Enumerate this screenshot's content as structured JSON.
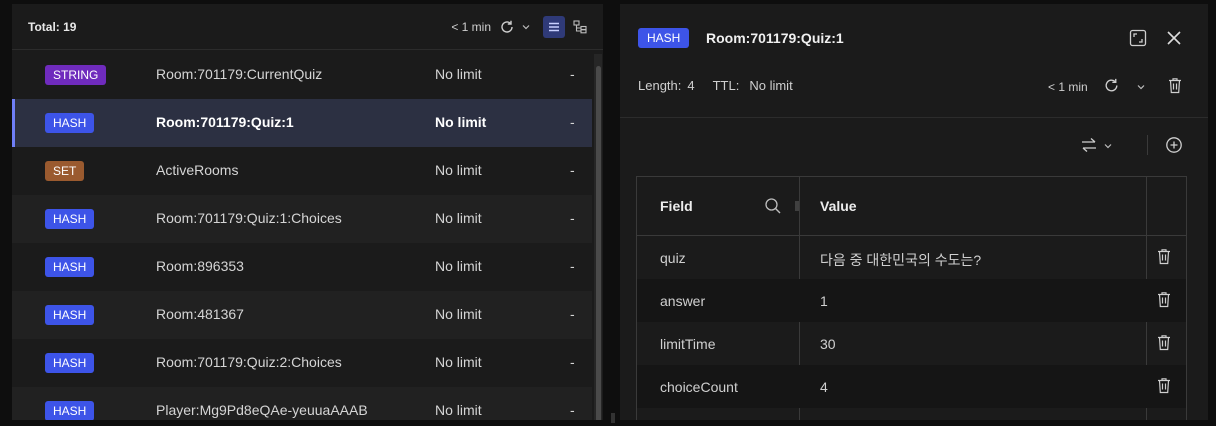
{
  "key_list": {
    "total_label": "Total: 19",
    "refresh_age": "< 1 min",
    "icons": {
      "refresh": "refresh-icon",
      "dropdown": "chevron-down-icon",
      "list_view": "list-view-icon",
      "tree_view": "tree-view-icon"
    },
    "rows": [
      {
        "type": "STRING",
        "name": "Room:701179:CurrentQuiz",
        "ttl": "No limit",
        "size": "-",
        "selected": false
      },
      {
        "type": "HASH",
        "name": "Room:701179:Quiz:1",
        "ttl": "No limit",
        "size": "-",
        "selected": true
      },
      {
        "type": "SET",
        "name": "ActiveRooms",
        "ttl": "No limit",
        "size": "-",
        "selected": false
      },
      {
        "type": "HASH",
        "name": "Room:701179:Quiz:1:Choices",
        "ttl": "No limit",
        "size": "-",
        "selected": false
      },
      {
        "type": "HASH",
        "name": "Room:896353",
        "ttl": "No limit",
        "size": "-",
        "selected": false
      },
      {
        "type": "HASH",
        "name": "Room:481367",
        "ttl": "No limit",
        "size": "-",
        "selected": false
      },
      {
        "type": "HASH",
        "name": "Room:701179:Quiz:2:Choices",
        "ttl": "No limit",
        "size": "-",
        "selected": false
      },
      {
        "type": "HASH",
        "name": "Player:Mg9Pd8eQAe-yeuuaAAAB",
        "ttl": "No limit",
        "size": "-",
        "selected": false
      }
    ]
  },
  "details": {
    "type": "HASH",
    "key_name": "Room:701179:Quiz:1",
    "length_label": "Length:",
    "length_value": "4",
    "ttl_label": "TTL:",
    "ttl_value": "No limit",
    "refresh_age": "< 1 min",
    "icons": {
      "fullscreen": "fullscreen-icon",
      "close": "close-icon",
      "refresh": "refresh-icon",
      "dropdown": "chevron-down-icon",
      "delete": "trash-icon",
      "format": "swap-arrows-icon",
      "add": "plus-circle-icon",
      "search": "search-icon"
    },
    "table": {
      "field_header": "Field",
      "value_header": "Value",
      "rows": [
        {
          "field": "quiz",
          "value": "다음 중 대한민국의 수도는?"
        },
        {
          "field": "answer",
          "value": "1"
        },
        {
          "field": "limitTime",
          "value": "30"
        },
        {
          "field": "choiceCount",
          "value": "4"
        }
      ]
    }
  },
  "colors": {
    "hash": "#3d54e8",
    "string": "#6f2bbd",
    "set": "#9a5a2f",
    "selected_row": "#2c3042",
    "accent": "#6f7ef7"
  }
}
